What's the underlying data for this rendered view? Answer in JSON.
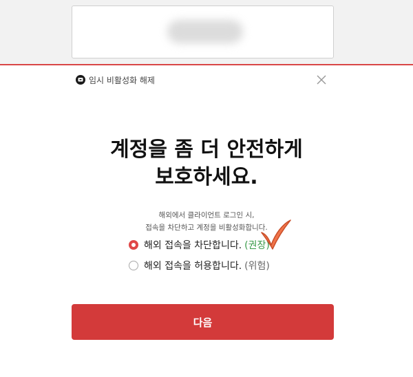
{
  "header": {
    "title": "임시 비활성화 해제",
    "close_icon": "close-icon"
  },
  "main": {
    "title_line1": "계정을 좀 더 안전하게",
    "title_line2": "보호하세요.",
    "desc_line1": "해외에서 클라이언트 로그인 시,",
    "desc_line2": "접속을 차단하고 계정을 비활성화합니다."
  },
  "options": [
    {
      "label": "해외 접속을 차단합니다.",
      "tag": "(권장)",
      "checked": true
    },
    {
      "label": "해외 접속을 허용합니다.",
      "tag": "(위험)",
      "checked": false
    }
  ],
  "next_button": {
    "label": "다음"
  },
  "colors": {
    "accent": "#d33a3a",
    "recommended": "#3a9a4a",
    "checkmark": "#f0744a"
  }
}
